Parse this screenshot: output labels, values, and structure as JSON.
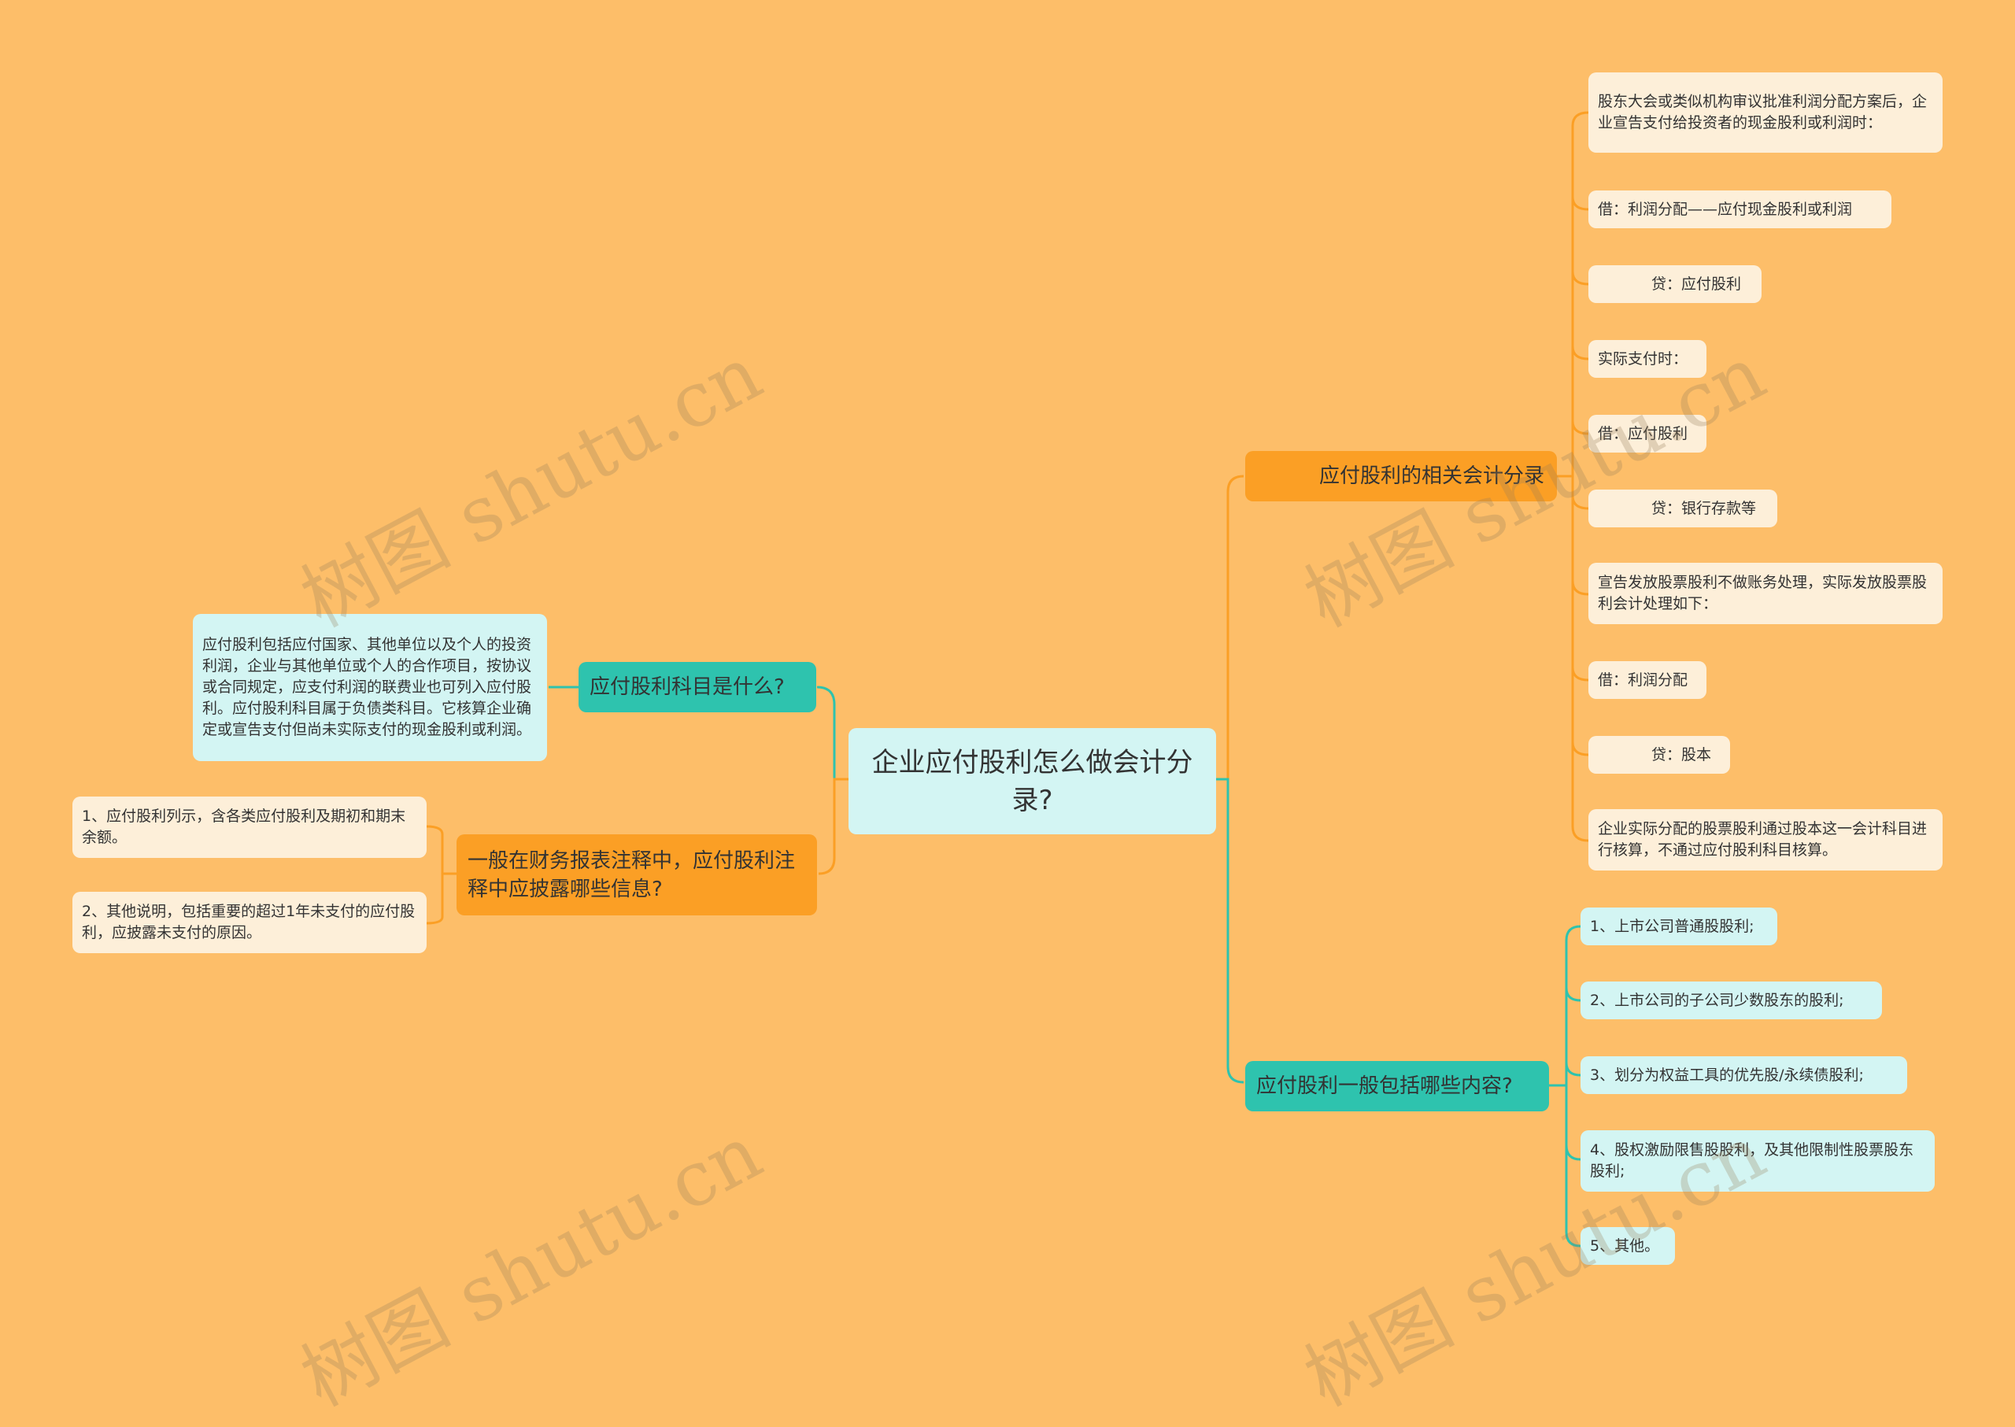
{
  "root": "企业应付股利怎么做会计分录?",
  "branches": {
    "entries": {
      "title": "应付股利的相关会计分录",
      "items": [
        "股东大会或类似机构审议批准利润分配方案后，企业宣告支付给投资者的现金股利或利润时：",
        "借：利润分配——应付现金股利或利润",
        "贷：应付股利",
        "实际支付时：",
        "借：应付股利",
        "贷：银行存款等",
        "宣告发放股票股利不做账务处理，实际发放股票股利会计处理如下：",
        "借：利润分配",
        "贷：股本",
        "企业实际分配的股票股利通过股本这一会计科目进行核算，不通过应付股利科目核算。"
      ]
    },
    "definition": {
      "title": "应付股利科目是什么?",
      "items": [
        "应付股利包括应付国家、其他单位以及个人的投资利润，企业与其他单位或个人的合作项目，按协议或合同规定，应支付利润的联费业也可列入应付股利。应付股利科目属于负债类科目。它核算企业确定或宣告支付但尚未实际支付的现金股利或利润。"
      ]
    },
    "disclosure": {
      "title": "一般在财务报表注释中，应付股利注释中应披露哪些信息?",
      "items": [
        "1、应付股利列示，含各类应付股利及期初和期末余额。",
        "2、其他说明，包括重要的超过1年未支付的应付股利，应披露未支付的原因。"
      ]
    },
    "contents": {
      "title": "应付股利一般包括哪些内容?",
      "items": [
        "1、上市公司普通股股利;",
        "2、上市公司的子公司少数股东的股利;",
        "3、划分为权益工具的优先股/永续债股利;",
        "4、股权激励限售股股利，及其他限制性股票股东股利;",
        "5、其他。"
      ]
    }
  },
  "watermark": "树图 shutu.cn",
  "colors": {
    "background": "#FDBE69",
    "orange_branch": "#FB9F25",
    "teal_branch": "#2EC3AE",
    "root_fill": "#D3F5F3",
    "cream_leaf": "#FDEFD9"
  }
}
